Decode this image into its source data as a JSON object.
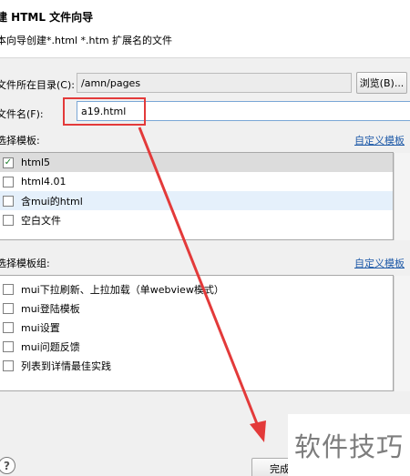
{
  "header": {
    "title": "建 HTML 文件向导",
    "description": "本向导创建*.html *.htm 扩展名的文件"
  },
  "directory": {
    "label": "文件所在目录(C):",
    "value": "/amn/pages",
    "browse_label": "浏览(B)..."
  },
  "filename": {
    "label": "文件名(F):",
    "value": "a19.html"
  },
  "templates": {
    "label": "选择模板:",
    "customize_label": "自定义模板",
    "items": [
      {
        "label": "html5",
        "checked": true
      },
      {
        "label": "html4.01",
        "checked": false
      },
      {
        "label": "含mui的html",
        "checked": false
      },
      {
        "label": "空白文件",
        "checked": false
      }
    ]
  },
  "template_groups": {
    "label": "选择模板组:",
    "customize_label": "自定义模板",
    "items": [
      {
        "label": "mui下拉刷新、上拉加载（单webview模式）",
        "checked": false
      },
      {
        "label": "mui登陆模板",
        "checked": false
      },
      {
        "label": "mui设置",
        "checked": false
      },
      {
        "label": "mui问题反馈",
        "checked": false
      },
      {
        "label": "列表到详情最佳实践",
        "checked": false
      }
    ]
  },
  "footer": {
    "help_label": "?",
    "finish_label": "完成"
  },
  "watermark": "软件技巧",
  "colors": {
    "annotation_red": "#e33a3a",
    "link_blue": "#1f5aa8",
    "check_green": "#1a7f2b"
  }
}
